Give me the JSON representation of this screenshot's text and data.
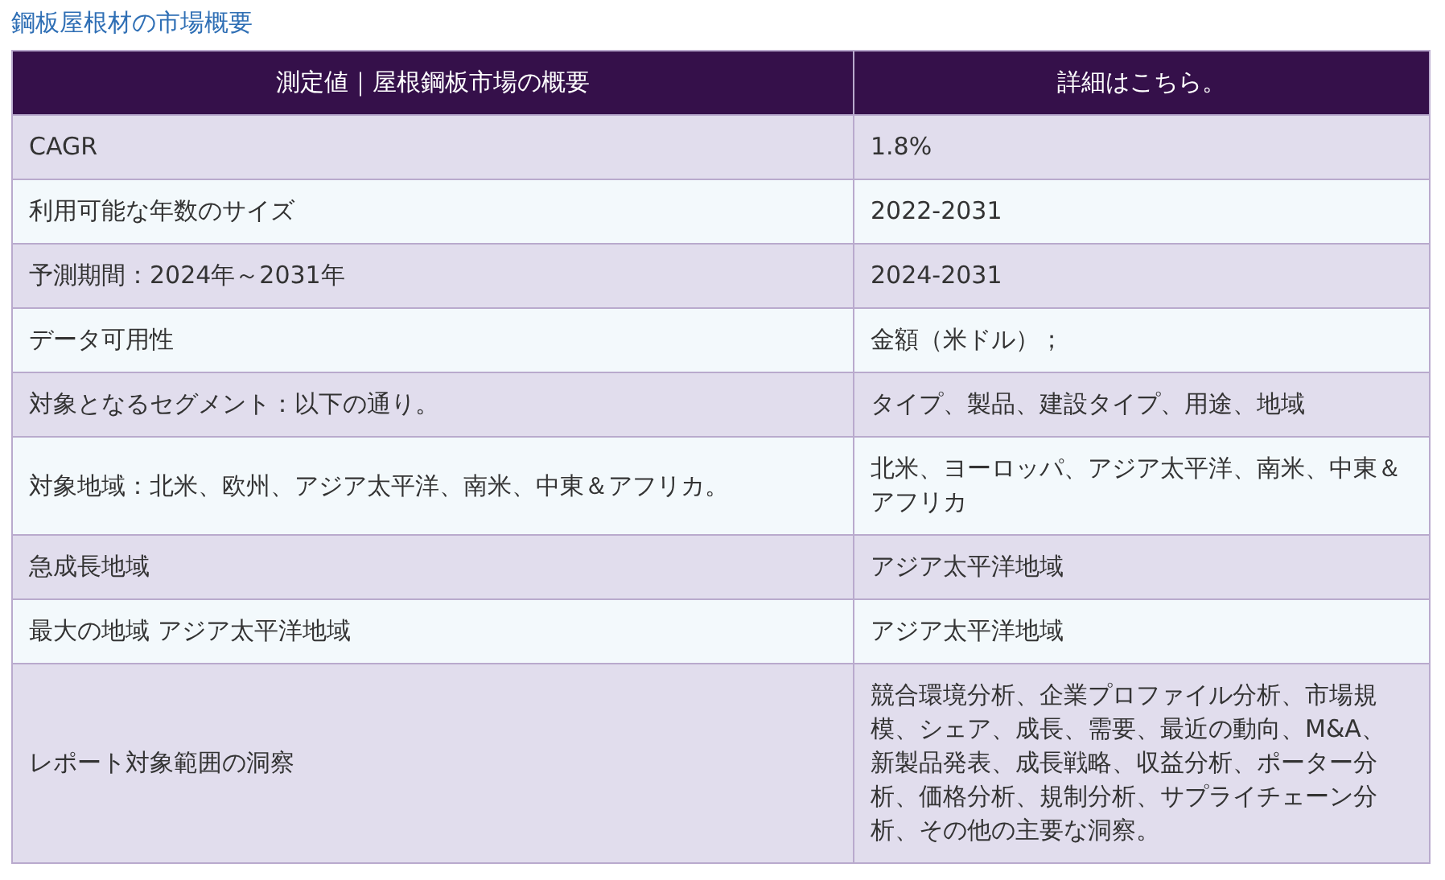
{
  "title": "鋼板屋根材の市場概要",
  "table": {
    "columns": [
      "測定値｜屋根鋼板市場の概要",
      "詳細はこちら。"
    ],
    "rows": [
      [
        "CAGR",
        "1.8%"
      ],
      [
        "利用可能な年数のサイズ",
        "2022-2031"
      ],
      [
        "予測期間：2024年～2031年",
        "2024-2031"
      ],
      [
        "データ可用性",
        "金額（米ドル）；"
      ],
      [
        "対象となるセグメント：以下の通り。",
        "タイプ、製品、建設タイプ、用途、地域"
      ],
      [
        "対象地域：北米、欧州、アジア太平洋、南米、中東＆アフリカ。",
        "北米、ヨーロッパ、アジア太平洋、南米、中東＆アフリカ"
      ],
      [
        "急成長地域",
        "アジア太平洋地域"
      ],
      [
        "最大の地域 アジア太平洋地域",
        "アジア太平洋地域"
      ],
      [
        "レポート対象範囲の洞察",
        "競合環境分析、企業プロファイル分析、市場規模、シェア、成長、需要、最近の動向、M&A、新製品発表、成長戦略、収益分析、ポーター分析、価格分析、規制分析、サプライチェーン分析、その他の主要な洞察。"
      ]
    ]
  }
}
